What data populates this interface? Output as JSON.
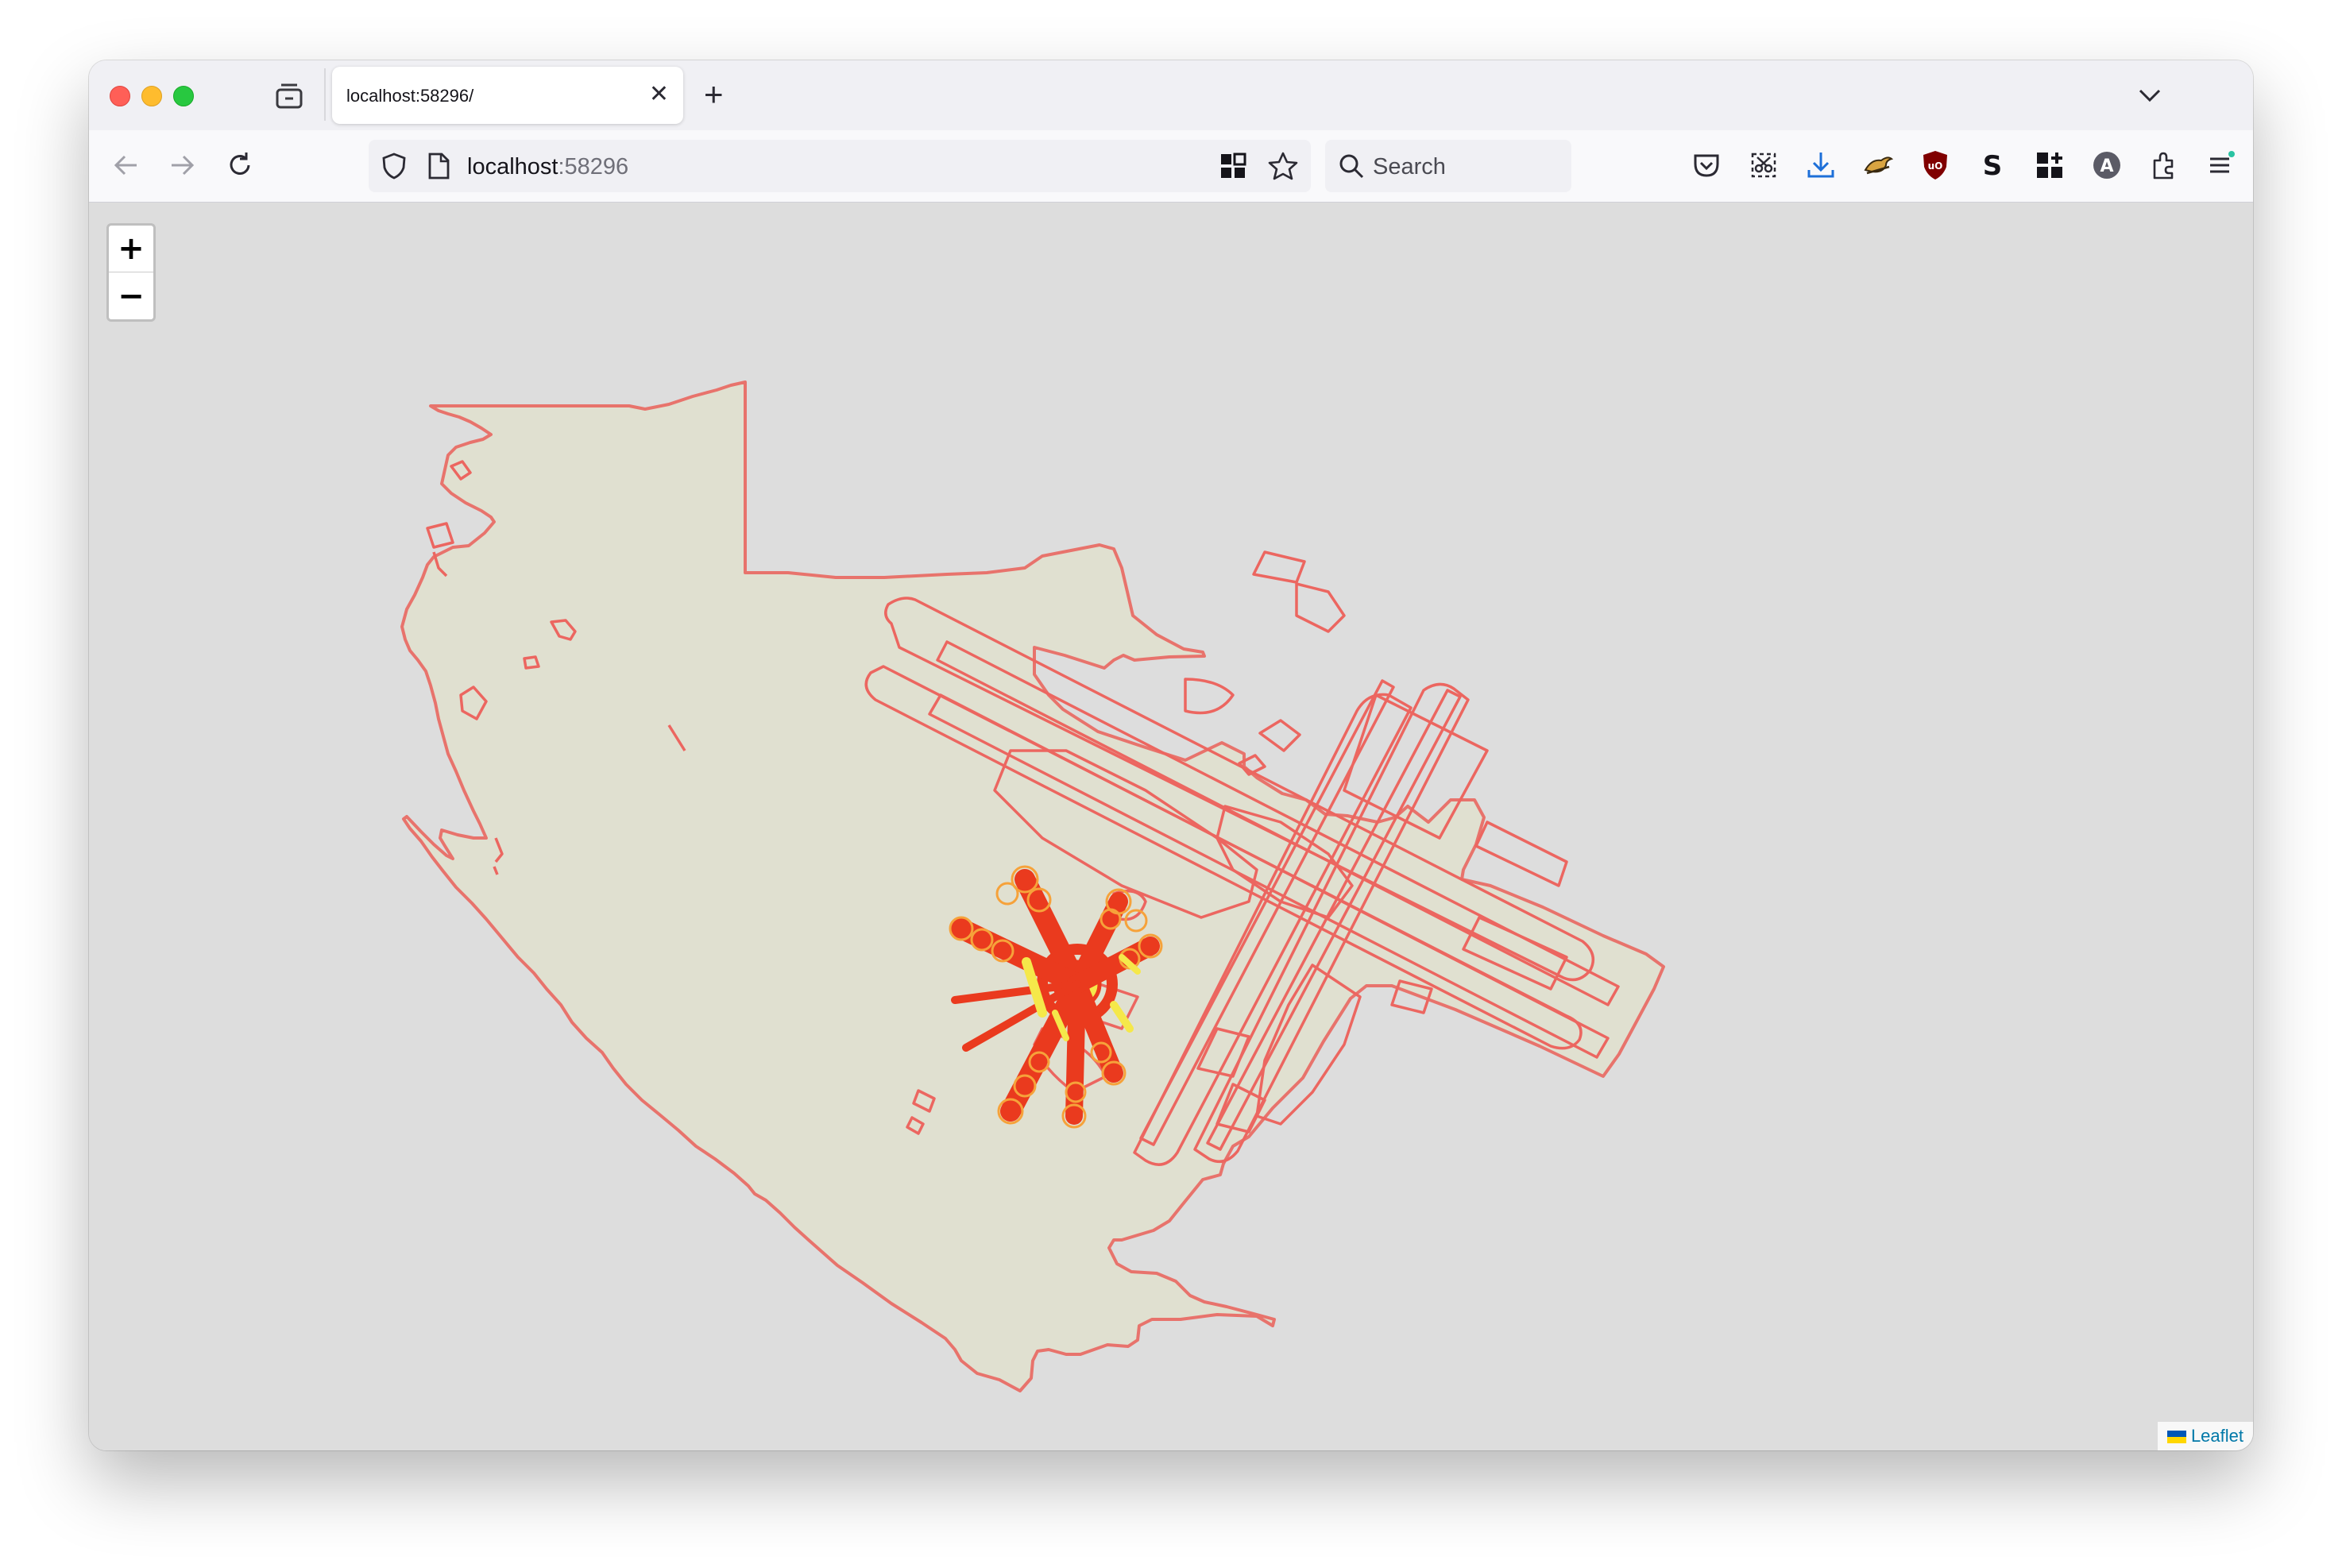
{
  "browser": {
    "tab_title": "localhost:58296/",
    "url_host": "localhost",
    "url_port": ":58296",
    "search_placeholder": "Search"
  },
  "map": {
    "zoom_in_label": "+",
    "zoom_out_label": "−",
    "attribution": "Leaflet",
    "colors": {
      "background": "#dddddd",
      "land_fill": "#e0e0d0",
      "outline": "#e8736c",
      "terminal_dense": "#ea3a1e",
      "terminal_core": "#f5e84a"
    }
  },
  "icons": [
    "tab-manager-icon",
    "close-tab-icon",
    "new-tab-icon",
    "list-all-tabs-icon",
    "back-icon",
    "forward-icon",
    "reload-icon",
    "shield-icon",
    "page-icon",
    "extension-grid-icon",
    "bookmark-star-icon",
    "search-icon",
    "pocket-icon",
    "screenshot-icon",
    "download-icon",
    "extension-bird-icon",
    "ublock-icon",
    "extension-s-icon",
    "extension-grid-plus-icon",
    "account-icon",
    "extensions-puzzle-icon",
    "menu-icon"
  ]
}
